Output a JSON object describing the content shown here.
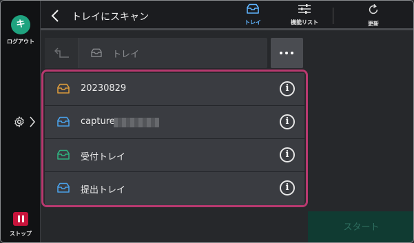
{
  "sidebar": {
    "logout_initial": "キ",
    "logout_label": "ログアウト",
    "stop_label": "ストップ"
  },
  "header": {
    "title": "トレイにスキャン",
    "buttons": [
      {
        "label": "トレイ",
        "icon": "tray-icon",
        "active": true
      },
      {
        "label": "機能リスト",
        "icon": "sliders-icon",
        "active": false
      },
      {
        "label": "更新",
        "icon": "refresh-icon",
        "active": false
      }
    ]
  },
  "path": {
    "text": "トレイ",
    "icon": "tray-icon"
  },
  "items": [
    {
      "name": "20230829",
      "icon": "tray-icon",
      "color": "#d99a3c"
    },
    {
      "name": "capture",
      "icon": "tray-icon",
      "color": "#4aa0e8"
    },
    {
      "name": "受付トレイ",
      "icon": "tray-icon",
      "color": "#2fb07f"
    },
    {
      "name": "提出トレイ",
      "icon": "tray-icon",
      "color": "#4aa0e8"
    }
  ],
  "start_label": "スタート",
  "colors": {
    "accent": "#5fb4ff",
    "logout": "#1fa37f",
    "stop": "#c8143c",
    "highlight": "#b8396f"
  }
}
